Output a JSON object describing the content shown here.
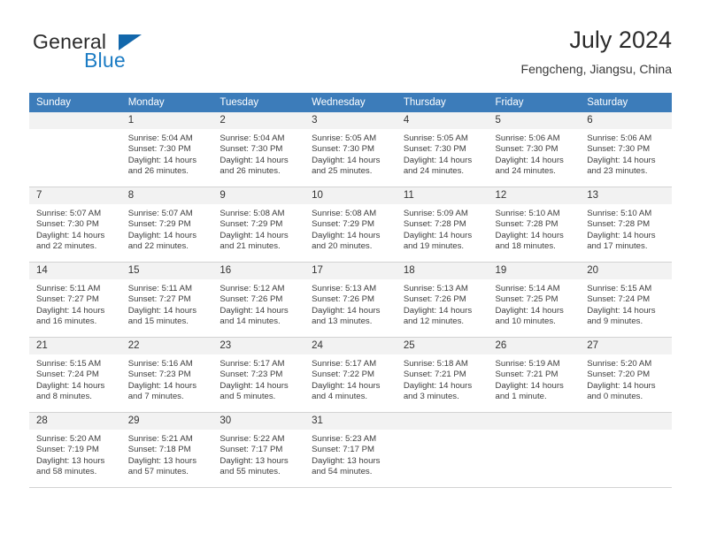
{
  "brand": {
    "name_part1": "General",
    "name_part2": "Blue",
    "logo_icon": "triangle-logo-icon"
  },
  "header": {
    "title": "July 2024",
    "subtitle": "Fengcheng, Jiangsu, China"
  },
  "calendar": {
    "weekday_headers": [
      "Sunday",
      "Monday",
      "Tuesday",
      "Wednesday",
      "Thursday",
      "Friday",
      "Saturday"
    ],
    "accent_color": "#3c7cba",
    "daynum_bg": "#f2f2f2",
    "weeks": [
      [
        {
          "day": "",
          "sunrise": "",
          "sunset": "",
          "daylight1": "",
          "daylight2": ""
        },
        {
          "day": "1",
          "sunrise": "Sunrise: 5:04 AM",
          "sunset": "Sunset: 7:30 PM",
          "daylight1": "Daylight: 14 hours",
          "daylight2": "and 26 minutes."
        },
        {
          "day": "2",
          "sunrise": "Sunrise: 5:04 AM",
          "sunset": "Sunset: 7:30 PM",
          "daylight1": "Daylight: 14 hours",
          "daylight2": "and 26 minutes."
        },
        {
          "day": "3",
          "sunrise": "Sunrise: 5:05 AM",
          "sunset": "Sunset: 7:30 PM",
          "daylight1": "Daylight: 14 hours",
          "daylight2": "and 25 minutes."
        },
        {
          "day": "4",
          "sunrise": "Sunrise: 5:05 AM",
          "sunset": "Sunset: 7:30 PM",
          "daylight1": "Daylight: 14 hours",
          "daylight2": "and 24 minutes."
        },
        {
          "day": "5",
          "sunrise": "Sunrise: 5:06 AM",
          "sunset": "Sunset: 7:30 PM",
          "daylight1": "Daylight: 14 hours",
          "daylight2": "and 24 minutes."
        },
        {
          "day": "6",
          "sunrise": "Sunrise: 5:06 AM",
          "sunset": "Sunset: 7:30 PM",
          "daylight1": "Daylight: 14 hours",
          "daylight2": "and 23 minutes."
        }
      ],
      [
        {
          "day": "7",
          "sunrise": "Sunrise: 5:07 AM",
          "sunset": "Sunset: 7:30 PM",
          "daylight1": "Daylight: 14 hours",
          "daylight2": "and 22 minutes."
        },
        {
          "day": "8",
          "sunrise": "Sunrise: 5:07 AM",
          "sunset": "Sunset: 7:29 PM",
          "daylight1": "Daylight: 14 hours",
          "daylight2": "and 22 minutes."
        },
        {
          "day": "9",
          "sunrise": "Sunrise: 5:08 AM",
          "sunset": "Sunset: 7:29 PM",
          "daylight1": "Daylight: 14 hours",
          "daylight2": "and 21 minutes."
        },
        {
          "day": "10",
          "sunrise": "Sunrise: 5:08 AM",
          "sunset": "Sunset: 7:29 PM",
          "daylight1": "Daylight: 14 hours",
          "daylight2": "and 20 minutes."
        },
        {
          "day": "11",
          "sunrise": "Sunrise: 5:09 AM",
          "sunset": "Sunset: 7:28 PM",
          "daylight1": "Daylight: 14 hours",
          "daylight2": "and 19 minutes."
        },
        {
          "day": "12",
          "sunrise": "Sunrise: 5:10 AM",
          "sunset": "Sunset: 7:28 PM",
          "daylight1": "Daylight: 14 hours",
          "daylight2": "and 18 minutes."
        },
        {
          "day": "13",
          "sunrise": "Sunrise: 5:10 AM",
          "sunset": "Sunset: 7:28 PM",
          "daylight1": "Daylight: 14 hours",
          "daylight2": "and 17 minutes."
        }
      ],
      [
        {
          "day": "14",
          "sunrise": "Sunrise: 5:11 AM",
          "sunset": "Sunset: 7:27 PM",
          "daylight1": "Daylight: 14 hours",
          "daylight2": "and 16 minutes."
        },
        {
          "day": "15",
          "sunrise": "Sunrise: 5:11 AM",
          "sunset": "Sunset: 7:27 PM",
          "daylight1": "Daylight: 14 hours",
          "daylight2": "and 15 minutes."
        },
        {
          "day": "16",
          "sunrise": "Sunrise: 5:12 AM",
          "sunset": "Sunset: 7:26 PM",
          "daylight1": "Daylight: 14 hours",
          "daylight2": "and 14 minutes."
        },
        {
          "day": "17",
          "sunrise": "Sunrise: 5:13 AM",
          "sunset": "Sunset: 7:26 PM",
          "daylight1": "Daylight: 14 hours",
          "daylight2": "and 13 minutes."
        },
        {
          "day": "18",
          "sunrise": "Sunrise: 5:13 AM",
          "sunset": "Sunset: 7:26 PM",
          "daylight1": "Daylight: 14 hours",
          "daylight2": "and 12 minutes."
        },
        {
          "day": "19",
          "sunrise": "Sunrise: 5:14 AM",
          "sunset": "Sunset: 7:25 PM",
          "daylight1": "Daylight: 14 hours",
          "daylight2": "and 10 minutes."
        },
        {
          "day": "20",
          "sunrise": "Sunrise: 5:15 AM",
          "sunset": "Sunset: 7:24 PM",
          "daylight1": "Daylight: 14 hours",
          "daylight2": "and 9 minutes."
        }
      ],
      [
        {
          "day": "21",
          "sunrise": "Sunrise: 5:15 AM",
          "sunset": "Sunset: 7:24 PM",
          "daylight1": "Daylight: 14 hours",
          "daylight2": "and 8 minutes."
        },
        {
          "day": "22",
          "sunrise": "Sunrise: 5:16 AM",
          "sunset": "Sunset: 7:23 PM",
          "daylight1": "Daylight: 14 hours",
          "daylight2": "and 7 minutes."
        },
        {
          "day": "23",
          "sunrise": "Sunrise: 5:17 AM",
          "sunset": "Sunset: 7:23 PM",
          "daylight1": "Daylight: 14 hours",
          "daylight2": "and 5 minutes."
        },
        {
          "day": "24",
          "sunrise": "Sunrise: 5:17 AM",
          "sunset": "Sunset: 7:22 PM",
          "daylight1": "Daylight: 14 hours",
          "daylight2": "and 4 minutes."
        },
        {
          "day": "25",
          "sunrise": "Sunrise: 5:18 AM",
          "sunset": "Sunset: 7:21 PM",
          "daylight1": "Daylight: 14 hours",
          "daylight2": "and 3 minutes."
        },
        {
          "day": "26",
          "sunrise": "Sunrise: 5:19 AM",
          "sunset": "Sunset: 7:21 PM",
          "daylight1": "Daylight: 14 hours",
          "daylight2": "and 1 minute."
        },
        {
          "day": "27",
          "sunrise": "Sunrise: 5:20 AM",
          "sunset": "Sunset: 7:20 PM",
          "daylight1": "Daylight: 14 hours",
          "daylight2": "and 0 minutes."
        }
      ],
      [
        {
          "day": "28",
          "sunrise": "Sunrise: 5:20 AM",
          "sunset": "Sunset: 7:19 PM",
          "daylight1": "Daylight: 13 hours",
          "daylight2": "and 58 minutes."
        },
        {
          "day": "29",
          "sunrise": "Sunrise: 5:21 AM",
          "sunset": "Sunset: 7:18 PM",
          "daylight1": "Daylight: 13 hours",
          "daylight2": "and 57 minutes."
        },
        {
          "day": "30",
          "sunrise": "Sunrise: 5:22 AM",
          "sunset": "Sunset: 7:17 PM",
          "daylight1": "Daylight: 13 hours",
          "daylight2": "and 55 minutes."
        },
        {
          "day": "31",
          "sunrise": "Sunrise: 5:23 AM",
          "sunset": "Sunset: 7:17 PM",
          "daylight1": "Daylight: 13 hours",
          "daylight2": "and 54 minutes."
        },
        {
          "day": "",
          "sunrise": "",
          "sunset": "",
          "daylight1": "",
          "daylight2": ""
        },
        {
          "day": "",
          "sunrise": "",
          "sunset": "",
          "daylight1": "",
          "daylight2": ""
        },
        {
          "day": "",
          "sunrise": "",
          "sunset": "",
          "daylight1": "",
          "daylight2": ""
        }
      ]
    ]
  }
}
